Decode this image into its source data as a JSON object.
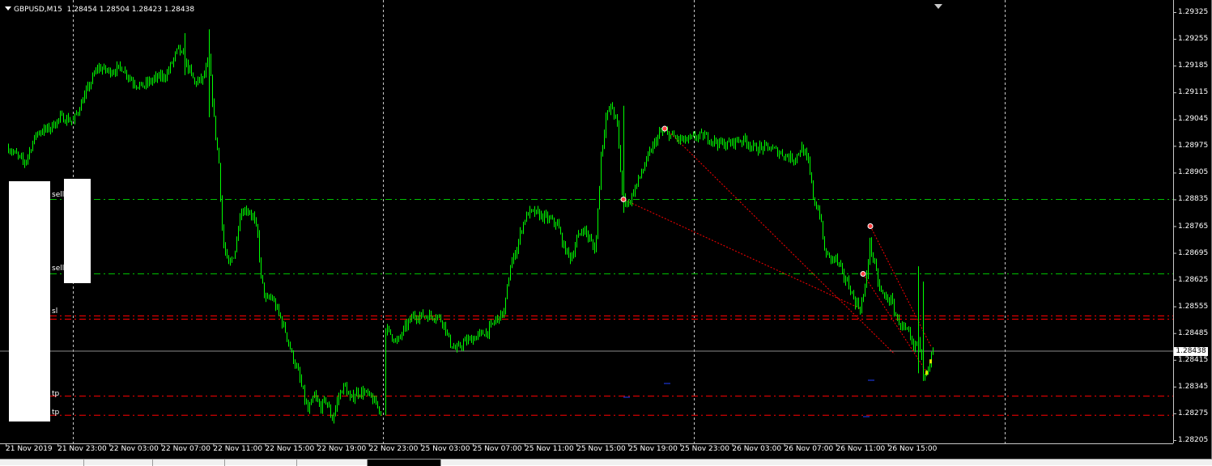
{
  "chart": {
    "symbol_label": "GBPUSD,M15",
    "ohlc": "1.28454 1.28504 1.28423 1.28438",
    "current_price": "1.28438",
    "y_ticks": [
      "1.29325",
      "1.29255",
      "1.29185",
      "1.29115",
      "1.29045",
      "1.28975",
      "1.28905",
      "1.28835",
      "1.28765",
      "1.28695",
      "1.28625",
      "1.28555",
      "1.28485",
      "1.28415",
      "1.28345",
      "1.28275",
      "1.28205"
    ],
    "x_ticks": [
      "21 Nov 2019",
      "21 Nov 23:00",
      "22 Nov 03:00",
      "22 Nov 07:00",
      "22 Nov 11:00",
      "22 Nov 15:00",
      "22 Nov 19:00",
      "22 Nov 23:00",
      "25 Nov 03:00",
      "25 Nov 07:00",
      "25 Nov 11:00",
      "25 Nov 15:00",
      "25 Nov 19:00",
      "25 Nov 23:00",
      "26 Nov 03:00",
      "26 Nov 07:00",
      "26 Nov 11:00",
      "26 Nov 15:00"
    ],
    "levels": {
      "sell_1": {
        "label": "sell",
        "price": 1.28835
      },
      "sell_2": {
        "label": "sell",
        "price": 1.2864
      },
      "sl": {
        "label": "sl",
        "price": 1.2853
      },
      "tp_1": {
        "label": "tp",
        "price": 1.2832
      },
      "tp_2": {
        "label": "tp",
        "price": 1.2827
      }
    },
    "colors": {
      "background": "#000000",
      "candle": "#00ff00",
      "sell_line": "#00c000",
      "sl_line": "#ff0000",
      "tp_line": "#ff0000",
      "trade_line": "#ff0000",
      "grid": "#c8c8c8"
    }
  },
  "chart_data": {
    "type": "line",
    "title": "GBPUSD,M15",
    "xlabel": "",
    "ylabel": "",
    "ylim": [
      1.28205,
      1.29325
    ],
    "x": [
      "21 Nov 2019",
      "21 Nov 23:00",
      "22 Nov 03:00",
      "22 Nov 07:00",
      "22 Nov 11:00",
      "22 Nov 15:00",
      "22 Nov 19:00",
      "22 Nov 23:00",
      "25 Nov 03:00",
      "25 Nov 07:00",
      "25 Nov 11:00",
      "25 Nov 15:00",
      "25 Nov 19:00",
      "25 Nov 23:00",
      "26 Nov 03:00",
      "26 Nov 07:00",
      "26 Nov 11:00",
      "26 Nov 15:00"
    ],
    "series": [
      {
        "values": [
          1.2905,
          1.2908,
          1.292,
          1.2922,
          1.2868,
          1.284,
          1.283,
          1.285,
          1.2855,
          1.285,
          1.288,
          1.291,
          1.2902,
          1.2898,
          1.2898,
          1.287,
          1.2858,
          1.2844
        ]
      }
    ]
  }
}
